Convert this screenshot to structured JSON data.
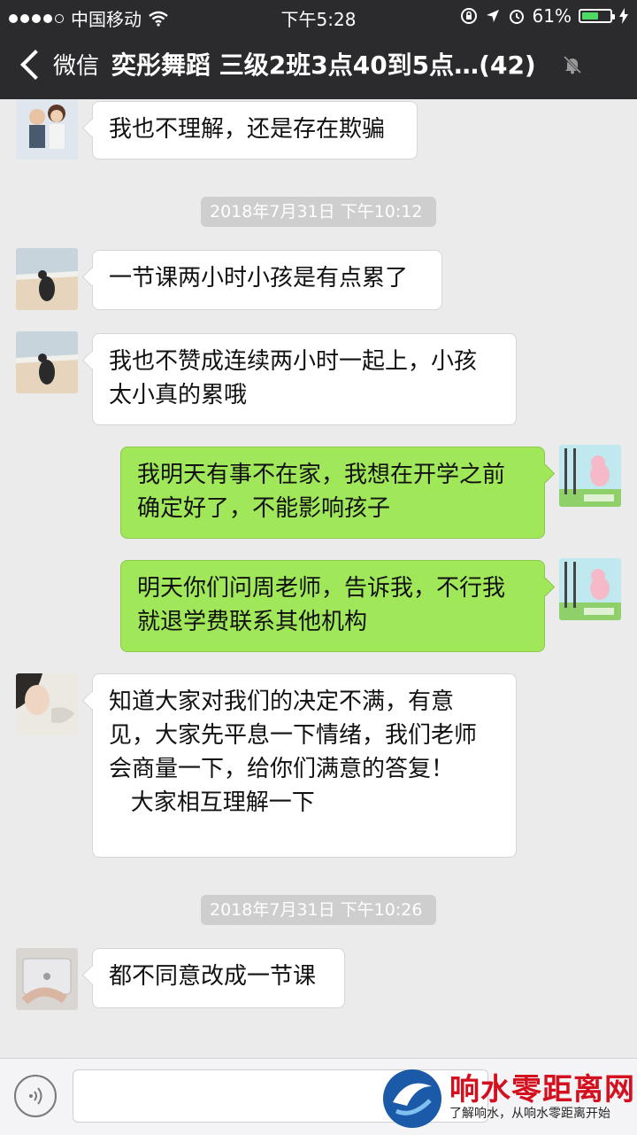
{
  "status_bar": {
    "carrier": "中国移动",
    "time": "下午5:28",
    "battery_percent": "61%",
    "battery_level": 0.61
  },
  "nav": {
    "back_label": "微信",
    "title": "奕彤舞蹈 三级2班3点40到5点…(42)"
  },
  "messages": [
    {
      "type": "in",
      "text": "我也不理解，还是存在欺骗"
    },
    {
      "type": "time",
      "text": "2018年7月31日 下午10:12"
    },
    {
      "type": "in",
      "text": "一节课两小时小孩是有点累了"
    },
    {
      "type": "in",
      "text": "我也不赞成连续两小时一起上，小孩\n太小真的累哦"
    },
    {
      "type": "out",
      "text": "我明天有事不在家，我想在开学之前\n确定好了，不能影响孩子"
    },
    {
      "type": "out",
      "text": "明天你们问周老师，告诉我，不行我\n就退学费联系其他机构"
    },
    {
      "type": "in",
      "text": "知道大家对我们的决定不满，有意\n见，大家先平息一下情绪，我们老师\n会商量一下，给你们满意的答复！\n   大家相互理解一下"
    },
    {
      "type": "time",
      "text": "2018年7月31日 下午10:26"
    },
    {
      "type": "in",
      "text": "都不同意改成一节课"
    }
  ],
  "watermark": {
    "title": "响水零距离网",
    "subtitle": "了解响水，从响水零距离开始"
  },
  "colors": {
    "nav_bg": "#2b2b2e",
    "chat_bg": "#ebebeb",
    "out_bubble": "#a0e75a",
    "in_bubble": "#ffffff",
    "watermark_red": "#d4101f"
  }
}
